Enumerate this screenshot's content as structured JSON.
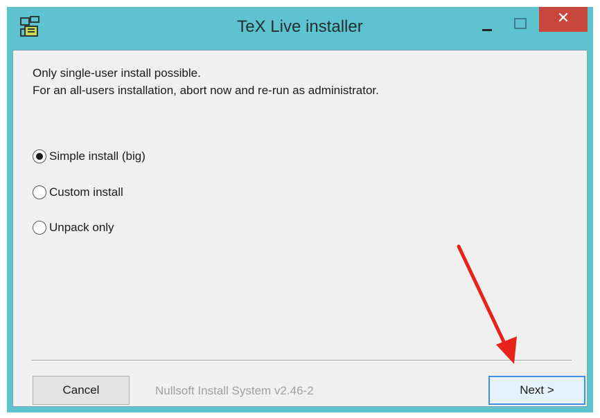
{
  "window": {
    "title": "TeX Live installer",
    "colors": {
      "titlebar": "#5fc3cf",
      "close": "#c9463d",
      "client": "#f0f0f0",
      "annotation_arrow": "#e8231b"
    }
  },
  "message": {
    "line1": "Only single-user install possible.",
    "line2": "For an all-users installation, abort now and re-run as administrator."
  },
  "options": [
    {
      "label": "Simple install (big)",
      "checked": true
    },
    {
      "label": "Custom install",
      "checked": false
    },
    {
      "label": "Unpack only",
      "checked": false
    }
  ],
  "footer": {
    "cancel_label": "Cancel",
    "system_label": "Nullsoft Install System v2.46-2",
    "next_label": "Next >"
  },
  "icons": {
    "app": "installer-icon",
    "minimize": "minimize-icon",
    "maximize": "maximize-icon",
    "close": "close-icon"
  }
}
